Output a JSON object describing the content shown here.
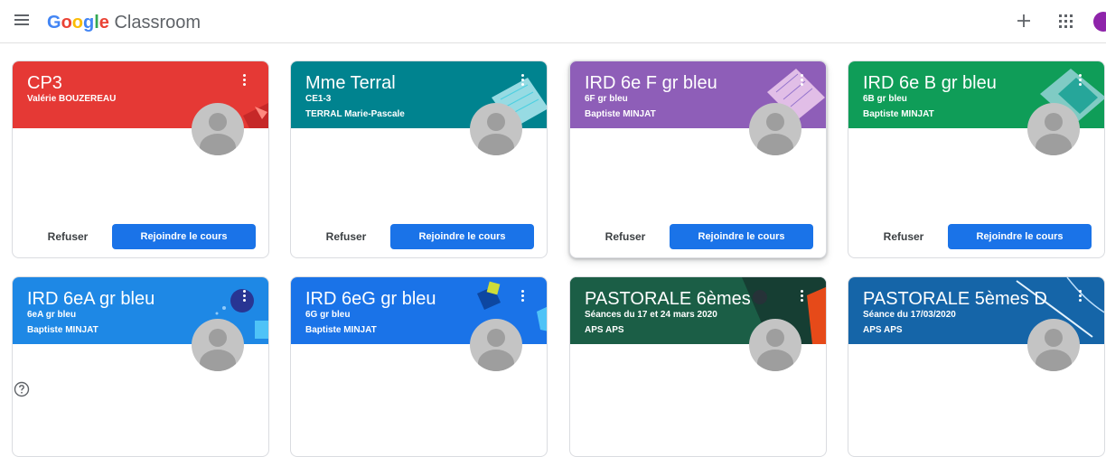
{
  "header": {
    "brand_google": "Google",
    "brand_product": "Classroom",
    "icons": [
      "menu-icon",
      "plus-icon",
      "apps-icon",
      "account-avatar"
    ]
  },
  "colors": {
    "red": "#e53935",
    "teal": "#00838f",
    "purple": "#8e5eb8",
    "green": "#0f9d58",
    "blue": "#1e88e5",
    "bright_blue": "#1a73e8",
    "dark_green": "#1b5e46",
    "navy": "#1565a8",
    "join_button": "#1a73e8"
  },
  "actions": {
    "decline": "Refuser",
    "join": "Rejoindre le cours"
  },
  "cards": [
    {
      "title": "CP3",
      "subtitle": "",
      "owner": "Valérie BOUZEREAU"
    },
    {
      "title": "Mme Terral",
      "subtitle": "CE1-3",
      "owner": "TERRAL Marie-Pascale"
    },
    {
      "title": "IRD 6e F gr bleu",
      "subtitle": "6F gr bleu",
      "owner": "Baptiste MINJAT"
    },
    {
      "title": "IRD 6e B gr bleu",
      "subtitle": "6B gr bleu",
      "owner": "Baptiste MINJAT"
    },
    {
      "title": "IRD 6eA gr bleu",
      "subtitle": "6eA gr bleu",
      "owner": "Baptiste MINJAT"
    },
    {
      "title": "IRD 6eG gr bleu",
      "subtitle": "6G gr bleu",
      "owner": "Baptiste MINJAT"
    },
    {
      "title": "PASTORALE 6èmes",
      "subtitle": "Séances du 17 et 24 mars 2020",
      "owner": "APS APS"
    },
    {
      "title": "PASTORALE 5èmes D",
      "subtitle": "Séance du 17/03/2020",
      "owner": "APS APS"
    }
  ],
  "footer": {
    "icon": "help-icon"
  }
}
